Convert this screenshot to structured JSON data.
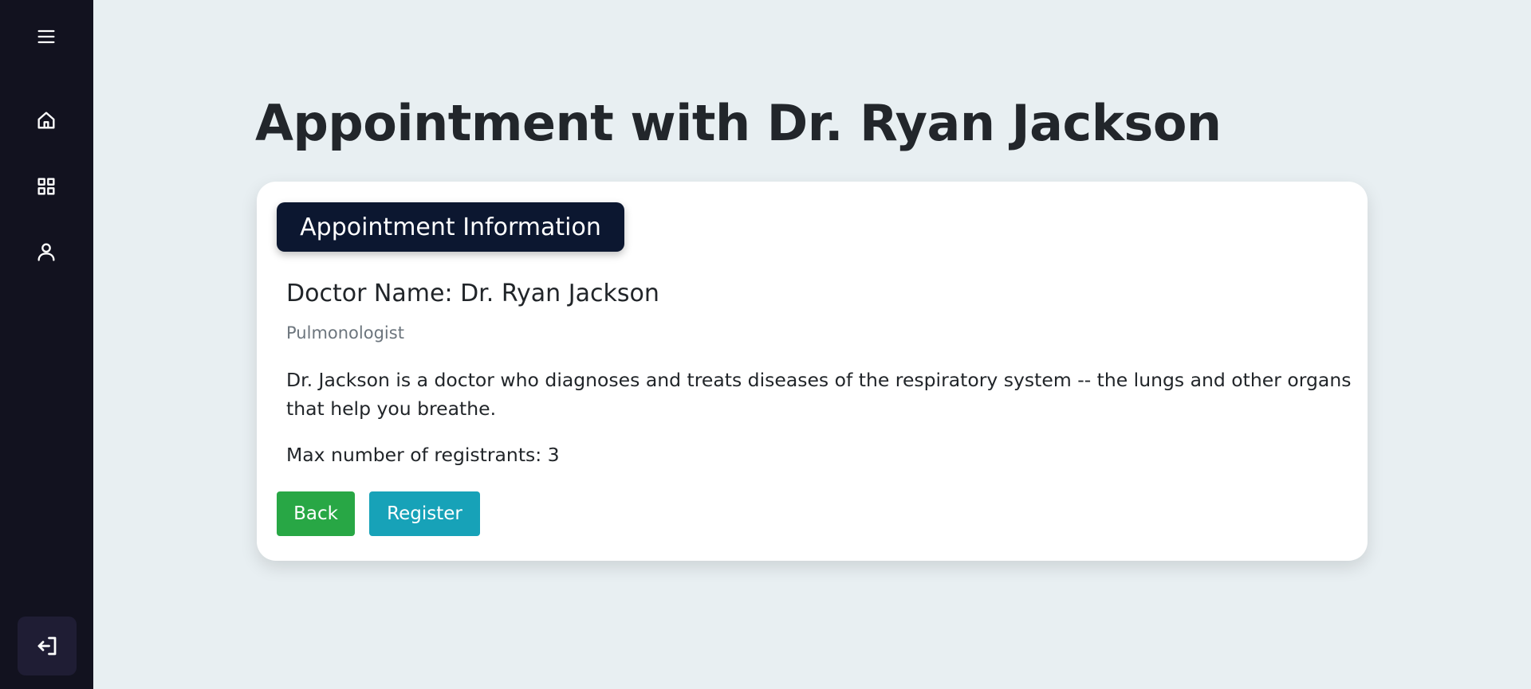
{
  "sidebar": {
    "items": [
      {
        "icon": "menu-icon"
      },
      {
        "icon": "home-icon"
      },
      {
        "icon": "grid-icon"
      },
      {
        "icon": "user-icon"
      }
    ],
    "logout": {
      "icon": "logout-icon"
    },
    "background": "#12121f"
  },
  "page": {
    "title": "Appointment with Dr. Ryan Jackson"
  },
  "card": {
    "header": "Appointment Information",
    "doctor_name": "Doctor Name: Dr. Ryan Jackson",
    "specialty": "Pulmonologist",
    "description": "Dr. Jackson is a doctor who diagnoses and treats diseases of the respiratory system -- the lungs and other organs that help you breathe.",
    "max_registrants": "Max number of registrants: 3",
    "buttons": {
      "back": "Back",
      "register": "Register"
    }
  },
  "colors": {
    "page_background": "#e8eff2",
    "header_badge": "#0c1730",
    "back_button": "#28a745",
    "register_button": "#17a2b8"
  }
}
